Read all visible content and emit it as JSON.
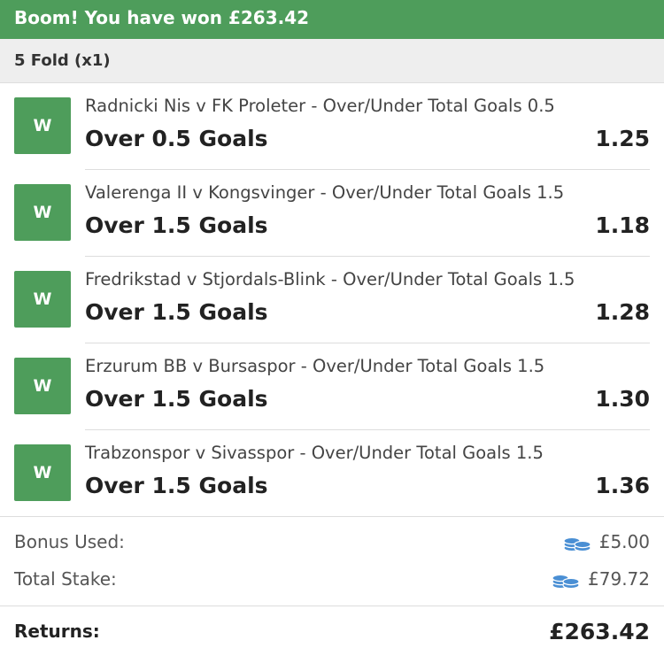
{
  "banner": {
    "text": "Boom! You have won £263.42"
  },
  "bet_type": "5 Fold (x1)",
  "legs": [
    {
      "result": "W",
      "market": "Radnicki Nis v FK Proleter - Over/Under Total Goals 0.5",
      "selection": "Over 0.5 Goals",
      "odds": "1.25"
    },
    {
      "result": "W",
      "market": "Valerenga II v Kongsvinger - Over/Under Total Goals 1.5",
      "selection": "Over 1.5 Goals",
      "odds": "1.18"
    },
    {
      "result": "W",
      "market": "Fredrikstad v Stjordals-Blink - Over/Under Total Goals 1.5",
      "selection": "Over 1.5 Goals",
      "odds": "1.28"
    },
    {
      "result": "W",
      "market": "Erzurum BB v Bursaspor - Over/Under Total Goals 1.5",
      "selection": "Over 1.5 Goals",
      "odds": "1.30"
    },
    {
      "result": "W",
      "market": "Trabzonspor v Sivasspor - Over/Under Total Goals 1.5",
      "selection": "Over 1.5 Goals",
      "odds": "1.36"
    }
  ],
  "summary": {
    "bonus_label": "Bonus Used:",
    "bonus_value": "£5.00",
    "stake_label": "Total Stake:",
    "stake_value": "£79.72",
    "icon": "coins-icon"
  },
  "returns": {
    "label": "Returns:",
    "value": "£263.42"
  },
  "colors": {
    "accent": "#4e9d5b",
    "coin": "#4a8fd4"
  }
}
